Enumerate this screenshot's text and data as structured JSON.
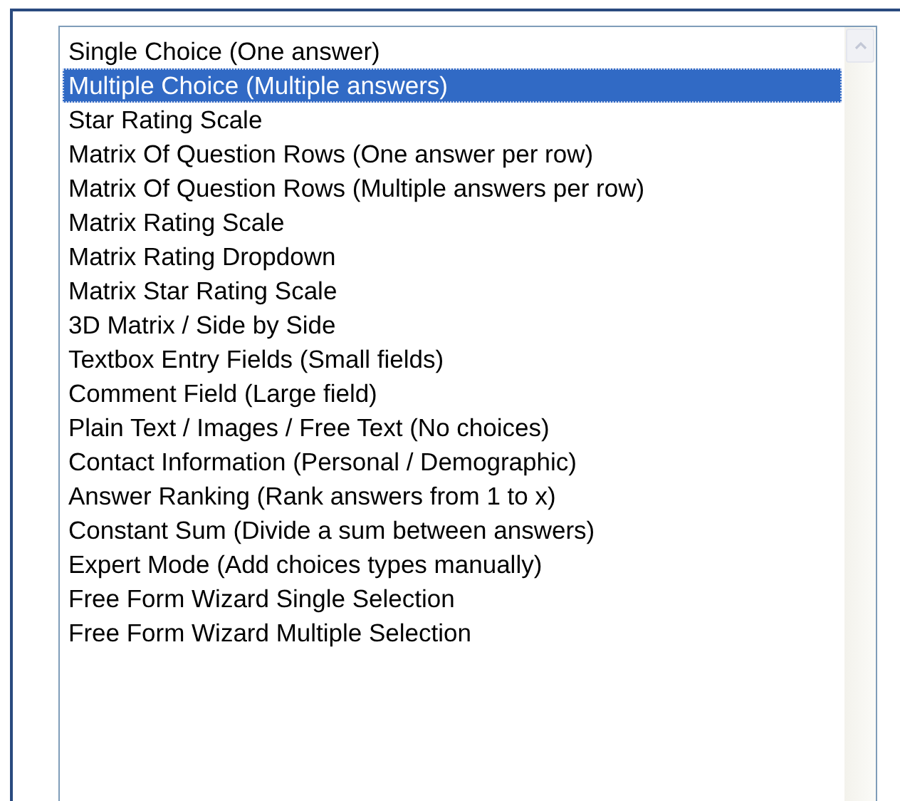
{
  "question_types": {
    "items": [
      {
        "label": "Single Choice (One answer)",
        "selected": false
      },
      {
        "label": "Multiple Choice (Multiple answers)",
        "selected": true
      },
      {
        "label": "Star Rating Scale",
        "selected": false
      },
      {
        "label": "Matrix Of Question Rows (One answer per row)",
        "selected": false
      },
      {
        "label": "Matrix Of Question Rows (Multiple answers per row)",
        "selected": false
      },
      {
        "label": "Matrix Rating Scale",
        "selected": false
      },
      {
        "label": "Matrix Rating Dropdown",
        "selected": false
      },
      {
        "label": "Matrix Star Rating Scale",
        "selected": false
      },
      {
        "label": "3D Matrix / Side by Side",
        "selected": false
      },
      {
        "label": "Textbox Entry Fields (Small fields)",
        "selected": false
      },
      {
        "label": "Comment Field (Large field)",
        "selected": false
      },
      {
        "label": "Plain Text / Images / Free Text (No choices)",
        "selected": false
      },
      {
        "label": "Contact Information (Personal / Demographic)",
        "selected": false
      },
      {
        "label": "Answer Ranking (Rank answers from 1 to x)",
        "selected": false
      },
      {
        "label": "Constant Sum (Divide a sum between answers)",
        "selected": false
      },
      {
        "label": "Expert Mode (Add choices types manually)",
        "selected": false
      },
      {
        "label": "Free Form Wizard Single Selection",
        "selected": false
      },
      {
        "label": "Free Form Wizard Multiple Selection",
        "selected": false
      }
    ]
  }
}
